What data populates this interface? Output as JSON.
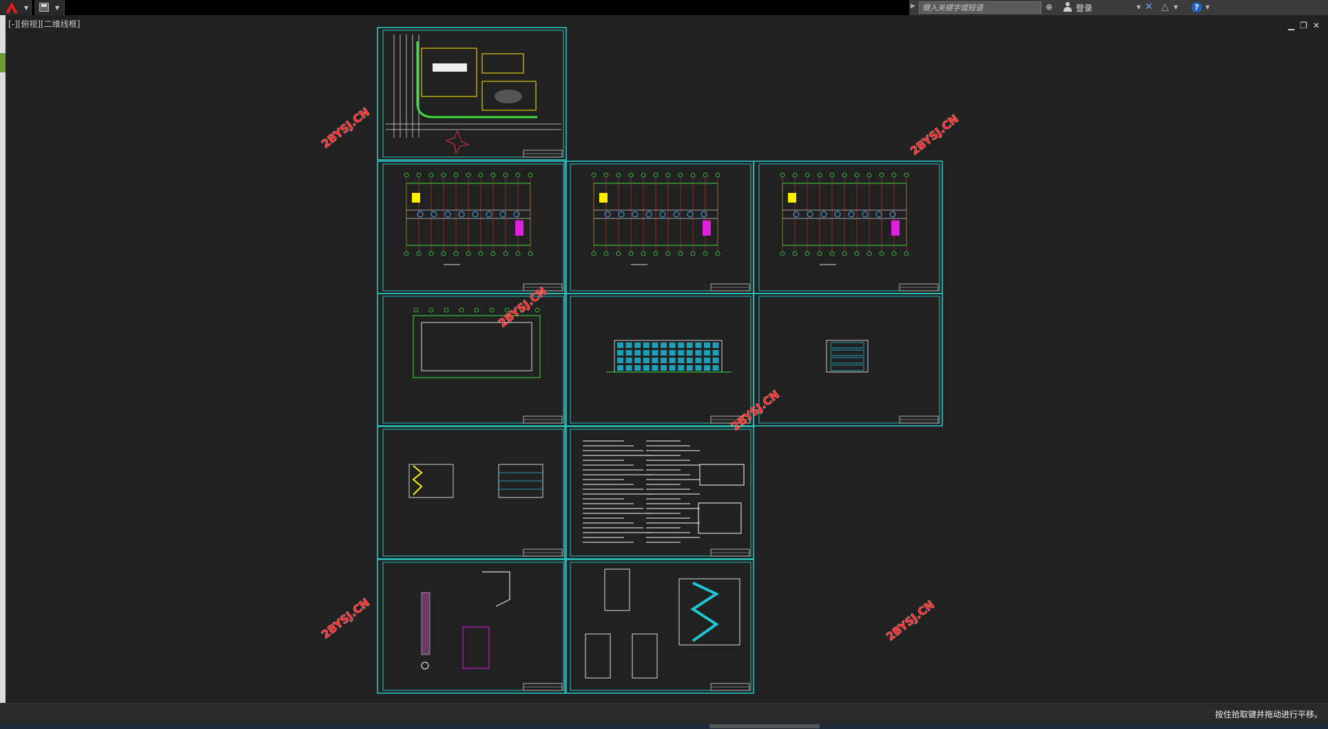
{
  "titlebar": {
    "app_icon": "autocad-a-icon",
    "search_placeholder": "键入关键字或短语",
    "login_label": "登录",
    "icons": [
      "binoculars-icon",
      "user-icon",
      "exchange-x-icon",
      "a360-icon",
      "help-icon"
    ]
  },
  "viewport": {
    "label": "[-][俯视][二维线框]",
    "window_controls": [
      "minimize-icon",
      "restore-icon",
      "close-icon"
    ]
  },
  "watermarks": [
    "2BYSJ.CN",
    "2BYSJ.CN",
    "2BYSJ.CN",
    "2BYSJ.CN",
    "2BYSJ.CN",
    "2BYSJ.CN"
  ],
  "sheets": [
    "site-plan",
    "floor-plan-1",
    "floor-plan-2",
    "floor-plan-3",
    "roof-plan",
    "front-elevation",
    "side-elevation",
    "section-views",
    "design-notes",
    "wall-details",
    "stair-details"
  ],
  "colors": {
    "background": "#212121",
    "sheet_frame": "#27c4c4",
    "lines_green": "#3dde3d",
    "watermark": "#ff2a2a",
    "accent_yellow": "#ffee00",
    "accent_magenta": "#e020e0"
  },
  "statusbar": {
    "message": "按住拾取键并拖动进行平移。"
  }
}
